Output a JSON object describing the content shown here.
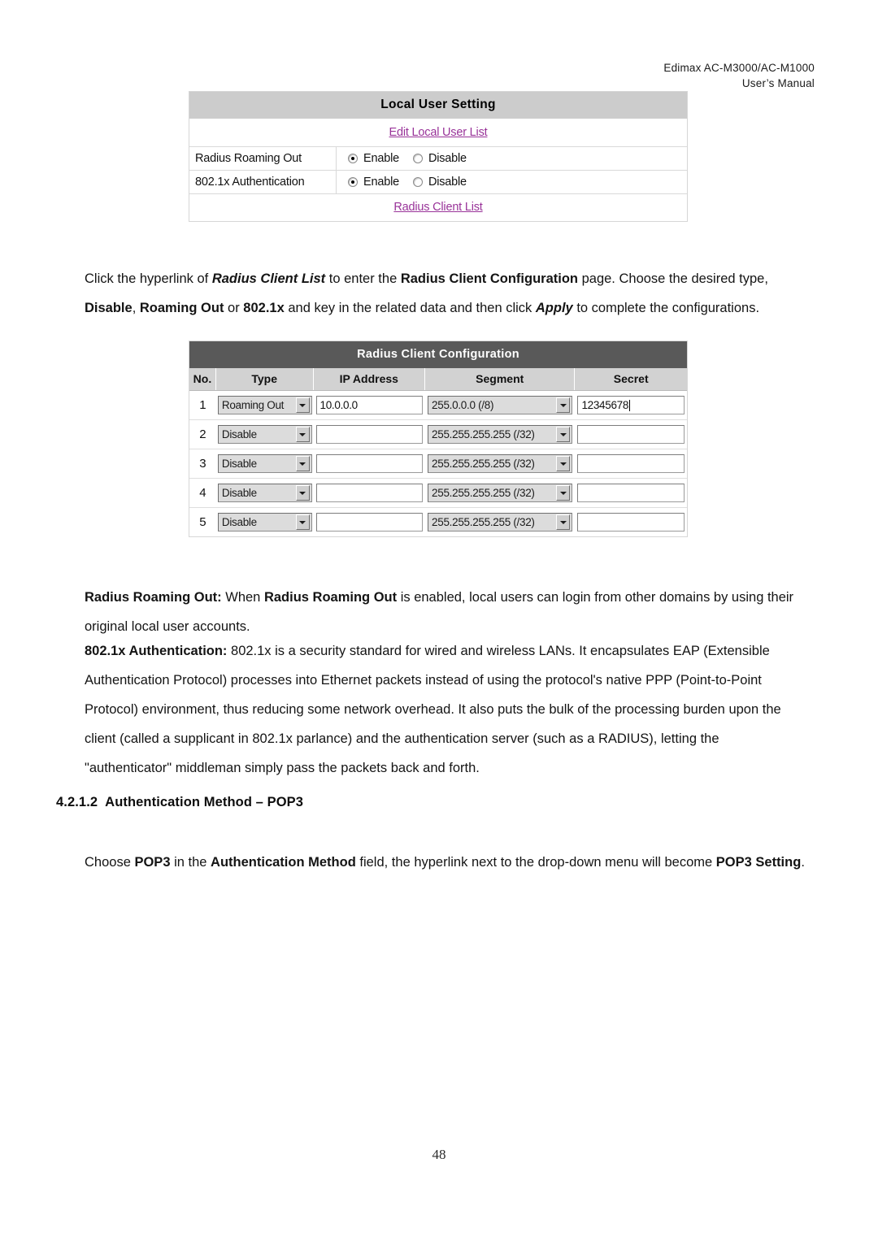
{
  "header": {
    "line1": "Edimax  AC-M3000/AC-M1000",
    "line2": "User’s  Manual"
  },
  "local_user_setting": {
    "title": "Local User Setting",
    "edit_link": "Edit Local User List",
    "rows": [
      {
        "label": "Radius Roaming Out",
        "enable_label": "Enable",
        "disable_label": "Disable",
        "selected": "Enable"
      },
      {
        "label": "802.1x Authentication",
        "enable_label": "Enable",
        "disable_label": "Disable",
        "selected": "Enable"
      }
    ],
    "radius_client_link": "Radius Client List"
  },
  "radius_client_config": {
    "title": "Radius Client Configuration",
    "columns": [
      "No.",
      "Type",
      "IP Address",
      "Segment",
      "Secret"
    ],
    "rows": [
      {
        "no": "1",
        "type": "Roaming Out",
        "ip": "10.0.0.0",
        "segment": "255.0.0.0 (/8)",
        "secret": "12345678"
      },
      {
        "no": "2",
        "type": "Disable",
        "ip": "",
        "segment": "255.255.255.255 (/32)",
        "secret": ""
      },
      {
        "no": "3",
        "type": "Disable",
        "ip": "",
        "segment": "255.255.255.255 (/32)",
        "secret": ""
      },
      {
        "no": "4",
        "type": "Disable",
        "ip": "",
        "segment": "255.255.255.255 (/32)",
        "secret": ""
      },
      {
        "no": "5",
        "type": "Disable",
        "ip": "",
        "segment": "255.255.255.255 (/32)",
        "secret": ""
      }
    ]
  },
  "body": {
    "para_click": {
      "s1": "Click the hyperlink of ",
      "bi1": "Radius Client List",
      "s2": " to enter the ",
      "b1": "Radius Client Configuration",
      "s3": " page. Choose the desired type, ",
      "b2": "Disable",
      "s4": ", ",
      "b3": "Roaming Out",
      "s5": " or ",
      "b4": "802.1x",
      "s6": " and key in the related data and then click ",
      "bi2": "Apply",
      "s7": " to complete the configurations."
    },
    "para_roaming": {
      "b1": "Radius Roaming Out:",
      "s1": " When ",
      "b2": "Radius Roaming Out",
      "s2": " is enabled, local users can login from other domains by using their original local user accounts."
    },
    "para_8021x": {
      "b1": "802.1x Authentication:",
      "s1": " 802.1x is a security standard for wired and wireless LANs. It encapsulates EAP (Extensible Authentication Protocol) processes into Ethernet packets instead of using the protocol's native PPP (Point-to-Point Protocol) environment, thus reducing some network overhead. It also puts the bulk of the processing burden upon the client (called a supplicant in 802.1x parlance) and the authentication server (such as a RADIUS), letting the \"authenticator\" middleman simply pass the packets back and forth."
    },
    "para_choose": {
      "s1": "Choose ",
      "b1": "POP3",
      "s2": " in the ",
      "b2": "Authentication Method",
      "s3": " field, the hyperlink next to the drop-down menu will become ",
      "b3": "POP3 Setting",
      "s4": "."
    }
  },
  "heading_4212": {
    "number": "4.2.1.2",
    "text": "Authentication Method – POP3"
  },
  "page_number": "48"
}
